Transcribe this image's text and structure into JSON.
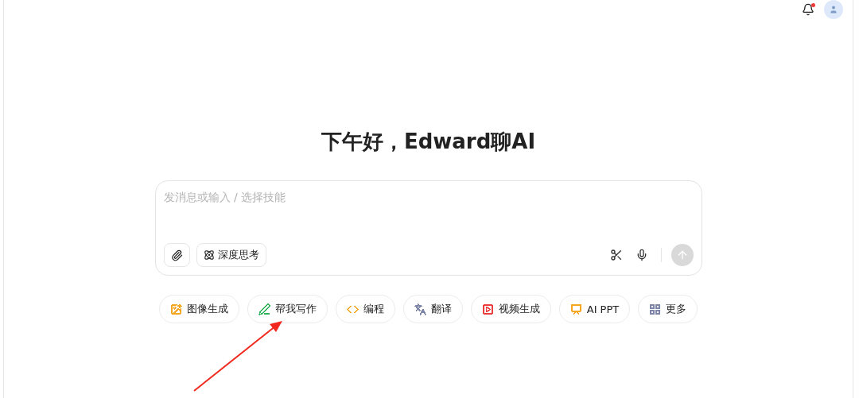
{
  "header": {
    "notifications": {
      "unread": true
    }
  },
  "greeting": "下午好，Edward聊AI",
  "composer": {
    "placeholder": "发消息或输入 / 选择技能",
    "deep_think": {
      "label": "深度思考"
    },
    "send": {
      "disabled": true
    }
  },
  "skills": [
    {
      "kind": "image",
      "label": "图像生成",
      "color": "#f5a623"
    },
    {
      "kind": "write",
      "label": "帮我写作",
      "color": "#34b45a"
    },
    {
      "kind": "code",
      "label": "编程",
      "color": "#f5a623"
    },
    {
      "kind": "translate",
      "label": "翻译",
      "color": "#7d86a8"
    },
    {
      "kind": "video",
      "label": "视频生成",
      "color": "#ee3f3f"
    },
    {
      "kind": "ppt",
      "label": "AI PPT",
      "color": "#f5a623"
    },
    {
      "kind": "more",
      "label": "更多",
      "color": "#7d86a8"
    }
  ]
}
